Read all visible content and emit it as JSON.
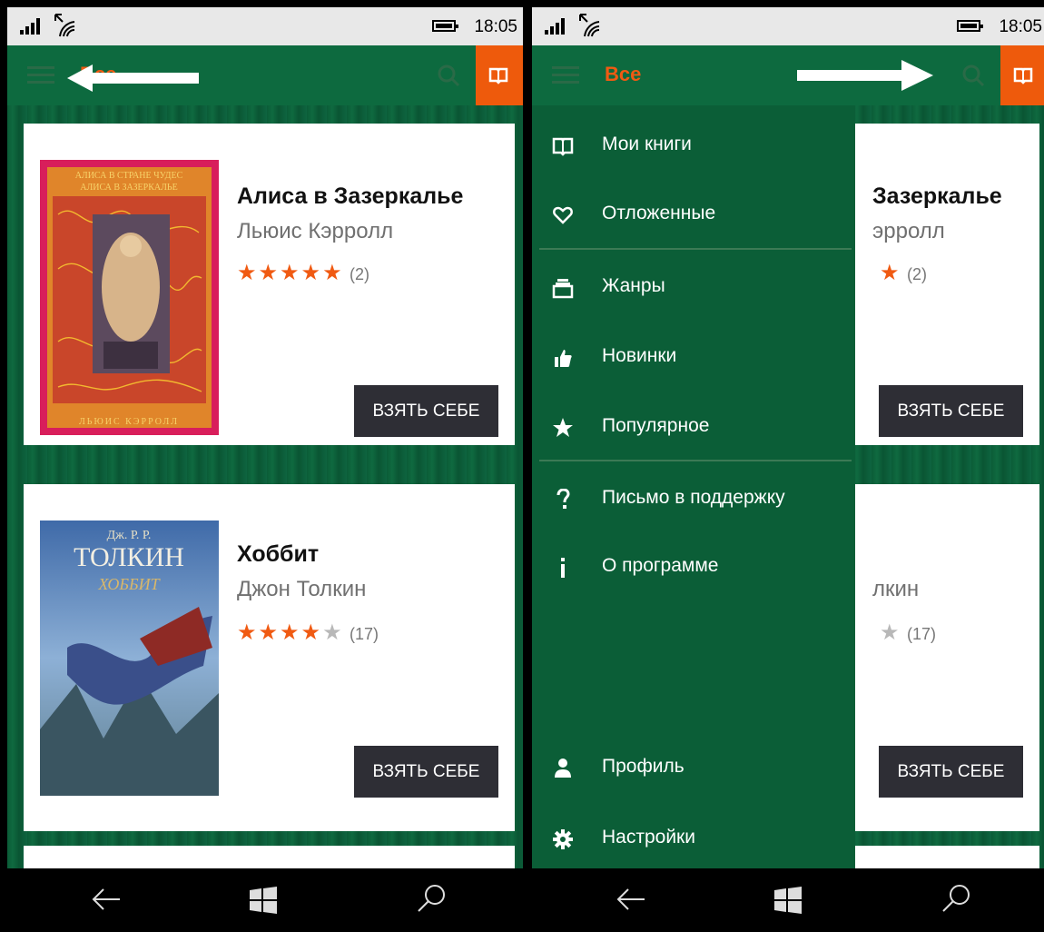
{
  "status_bar": {
    "time": "18:05"
  },
  "app_bar": {
    "title": "Все"
  },
  "books": [
    {
      "title": "Алиса в Зазеркалье",
      "author": "Льюис Кэррolл",
      "stars": "★★★★★",
      "half_star": "",
      "rating_count": "(2)",
      "button": "ВЗЯТЬ СЕБЕ",
      "cover_top": "АЛИСА В СТРАНЕ ЧУДЕС",
      "cover_top2": "АЛИСА В ЗАЗЕРКАЛЬЕ",
      "cover_bottom": "ЛЬЮИС КЭРРОЛЛ"
    },
    {
      "title": "Хоббит",
      "author": "Джон Толкин",
      "stars": "★★★★",
      "half_star": "★",
      "rating_count": "(17)",
      "button": "ВЗЯТЬ СЕБЕ",
      "cover_top": "Дж. Р. Р.",
      "cover_top2": "ТОЛКИН",
      "cover_bottom": "ХОББИТ"
    }
  ],
  "right_partial": {
    "title_fragment": "Зазеркалье",
    "author_fragment": "эрролл",
    "author2_fragment": "лкин",
    "rating_count_1": "(2)",
    "rating_count_2": "(17)",
    "button": "ВЗЯТЬ СЕБЕ"
  },
  "menu": {
    "items": [
      {
        "label": "Мои книги",
        "icon": "book-icon"
      },
      {
        "label": "Отложенные",
        "icon": "heart-icon"
      },
      {
        "label": "Жанры",
        "icon": "stack-icon"
      },
      {
        "label": "Новинки",
        "icon": "thumbs-up-icon"
      },
      {
        "label": "Популярное",
        "icon": "star-icon"
      },
      {
        "label": "Письмо в поддержку",
        "icon": "question-icon"
      },
      {
        "label": "О программе",
        "icon": "info-icon"
      },
      {
        "label": "Профиль",
        "icon": "person-icon"
      },
      {
        "label": "Настройки",
        "icon": "gear-icon"
      }
    ]
  },
  "colors": {
    "accent": "#ee5a0c",
    "app_green": "#0d6a3f",
    "button_dark": "#2e2e35"
  }
}
